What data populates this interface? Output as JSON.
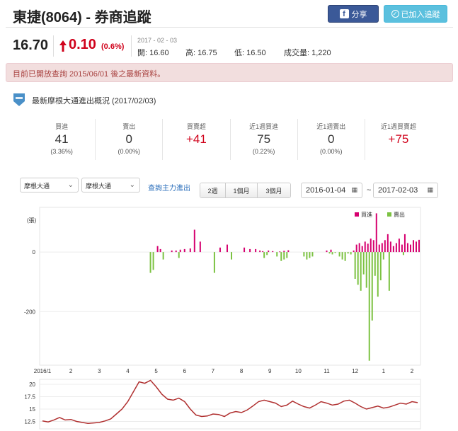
{
  "header": {
    "title": "東捷(8064) - 券商追蹤",
    "share_label": "分享",
    "follow_label": "已加入追蹤"
  },
  "quote": {
    "price": "16.70",
    "change": "0.10",
    "change_pct": "(0.6%)",
    "date": "2017 - 02 - 03",
    "open_label": "開: 16.60",
    "high_label": "高: 16.75",
    "low_label": "低: 16.50",
    "volume_label": "成交量: 1,220"
  },
  "notice": "目前已開放查詢 2015/06/01 後之最新資料。",
  "section": {
    "title": "最新摩根大通進出概況 (2017/02/03)"
  },
  "stats": [
    {
      "label": "買進",
      "value": "41",
      "sub": "(3.36%)",
      "color": "#333333"
    },
    {
      "label": "賣出",
      "value": "0",
      "sub": "(0.00%)",
      "color": "#333333"
    },
    {
      "label": "買賣超",
      "value": "+41",
      "sub": "",
      "color": "#d0021b"
    },
    {
      "label": "近1週買進",
      "value": "75",
      "sub": "(0.22%)",
      "color": "#333333"
    },
    {
      "label": "近1週賣出",
      "value": "0",
      "sub": "(0.00%)",
      "color": "#333333"
    },
    {
      "label": "近1週買賣超",
      "value": "+75",
      "sub": "",
      "color": "#d0021b"
    }
  ],
  "controls": {
    "select1": "摩根大通",
    "select2": "摩根大通",
    "link": "查詢主力進出",
    "ranges": [
      "2週",
      "1個月",
      "3個月"
    ],
    "date_from": "2016-01-04",
    "date_to": "2017-02-03",
    "tilde": "~"
  },
  "chart_data": [
    {
      "type": "bar",
      "ylabel": "(張)",
      "y_ticks": [
        "0",
        "-200"
      ],
      "ylim": [
        -380,
        150
      ],
      "legend": [
        {
          "name": "買進",
          "color": "#d6006f"
        },
        {
          "name": "賣出",
          "color": "#7cc242"
        }
      ],
      "legend_position": "top-right",
      "x_labels": [
        "2016/1",
        "2",
        "3",
        "4",
        "5",
        "6",
        "7",
        "8",
        "9",
        "10",
        "11",
        "12",
        "1",
        "2"
      ],
      "grid": "horizontal",
      "series": [
        {
          "name": "買進",
          "x": [
            5.05,
            5.15,
            5.55,
            5.7,
            5.85,
            6.0,
            6.2,
            6.35,
            6.55,
            7.25,
            7.5,
            8.1,
            8.3,
            8.5,
            8.65,
            8.75,
            8.95,
            9.1,
            9.35,
            9.5,
            9.65,
            11.0,
            11.15,
            11.95,
            12.05,
            12.15,
            12.25,
            12.35,
            12.45,
            12.55,
            12.65,
            12.75,
            12.85,
            12.95,
            13.05,
            13.15,
            13.25,
            13.35,
            13.45,
            13.55,
            13.65,
            13.75,
            13.85,
            13.95,
            14.05,
            14.15,
            14.25
          ],
          "values": [
            20,
            10,
            5,
            5,
            8,
            10,
            12,
            75,
            35,
            15,
            25,
            15,
            10,
            10,
            5,
            3,
            5,
            3,
            2,
            4,
            6,
            5,
            8,
            5,
            25,
            30,
            20,
            35,
            28,
            45,
            40,
            130,
            25,
            30,
            40,
            60,
            35,
            20,
            30,
            45,
            25,
            60,
            30,
            25,
            40,
            35,
            41
          ],
          "color": "#d6006f"
        },
        {
          "name": "賣出",
          "x": [
            4.8,
            4.9,
            5.25,
            5.8,
            7.05,
            7.65,
            8.8,
            8.9,
            9.25,
            9.4,
            9.5,
            9.6,
            10.2,
            10.3,
            10.4,
            10.5,
            11.1,
            11.2,
            11.3,
            11.45,
            11.55,
            11.65,
            11.75,
            11.85,
            12.0,
            12.1,
            12.2,
            12.3,
            12.4,
            12.5,
            12.6,
            12.7,
            12.8,
            12.9,
            13.0,
            13.2,
            13.7
          ],
          "values": [
            -70,
            -60,
            -25,
            -20,
            -70,
            -25,
            -20,
            -10,
            -15,
            -30,
            -25,
            -20,
            -15,
            -25,
            -20,
            -15,
            -5,
            -8,
            -3,
            -15,
            -25,
            -30,
            -5,
            -8,
            -90,
            -110,
            -130,
            -75,
            -120,
            -365,
            -230,
            -80,
            -150,
            -95,
            -25,
            -130,
            -10
          ],
          "color": "#7cc242"
        }
      ]
    },
    {
      "type": "line",
      "y_ticks": [
        "20",
        "17.5",
        "15",
        "12.5"
      ],
      "ylim": [
        11,
        21
      ],
      "series": [
        {
          "name": "",
          "x": [
            1,
            1.2,
            1.4,
            1.6,
            1.8,
            2,
            2.2,
            2.4,
            2.6,
            2.8,
            3,
            3.2,
            3.4,
            3.6,
            3.8,
            4,
            4.2,
            4.4,
            4.6,
            4.8,
            5,
            5.2,
            5.4,
            5.6,
            5.8,
            6,
            6.2,
            6.4,
            6.6,
            6.8,
            7,
            7.2,
            7.4,
            7.6,
            7.8,
            8,
            8.2,
            8.4,
            8.6,
            8.8,
            9,
            9.2,
            9.4,
            9.6,
            9.8,
            10,
            10.2,
            10.4,
            10.6,
            10.8,
            11,
            11.2,
            11.4,
            11.6,
            11.8,
            12,
            12.2,
            12.4,
            12.6,
            12.8,
            13,
            13.2,
            13.4,
            13.6,
            13.8,
            14,
            14.2
          ],
          "values": [
            12.6,
            12.4,
            12.8,
            13.3,
            12.8,
            12.9,
            12.5,
            12.3,
            12.1,
            12.2,
            12.3,
            12.6,
            13.0,
            14.0,
            15.0,
            16.5,
            18.5,
            20.5,
            20.2,
            20.8,
            19.5,
            18.0,
            17.0,
            16.8,
            17.2,
            16.5,
            15.0,
            13.8,
            13.5,
            13.6,
            14.0,
            13.9,
            13.5,
            14.2,
            14.5,
            14.3,
            14.8,
            15.6,
            16.5,
            16.8,
            16.5,
            16.2,
            15.5,
            15.8,
            16.6,
            16.0,
            15.5,
            15.2,
            15.8,
            16.5,
            16.2,
            15.8,
            16.0,
            16.6,
            16.8,
            16.2,
            15.5,
            15.0,
            15.3,
            15.6,
            15.2,
            15.4,
            15.8,
            16.2,
            16.0,
            16.5,
            16.3
          ],
          "color": "#b03030"
        }
      ]
    }
  ]
}
